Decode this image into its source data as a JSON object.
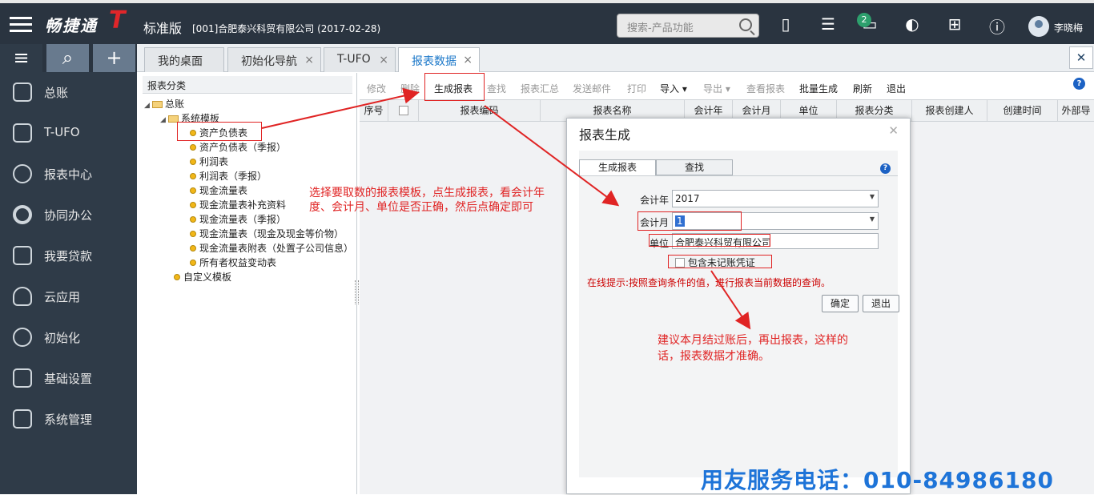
{
  "app": {
    "logo_text": "畅捷通",
    "logo_t": "T",
    "edition": "标准版",
    "company": "[001]合肥泰兴科贸有限公司  (2017-02-28)"
  },
  "search": {
    "placeholder": "搜索-产品功能"
  },
  "notifications": {
    "count": "2"
  },
  "user": {
    "name": "李晓梅"
  },
  "sidebar": {
    "items": [
      {
        "label": "总账",
        "icon": "ledger-icon"
      },
      {
        "label": "T-UFO",
        "icon": "ufo-icon"
      },
      {
        "label": "报表中心",
        "icon": "chart-icon"
      },
      {
        "label": "协同办公",
        "icon": "collaboration-icon"
      },
      {
        "label": "我要贷款",
        "icon": "loan-icon"
      },
      {
        "label": "云应用",
        "icon": "cloud-icon"
      },
      {
        "label": "初始化",
        "icon": "init-icon"
      },
      {
        "label": "基础设置",
        "icon": "settings-icon"
      },
      {
        "label": "系统管理",
        "icon": "system-icon"
      }
    ]
  },
  "tabs": [
    {
      "label": "我的桌面"
    },
    {
      "label": "初始化导航"
    },
    {
      "label": "T-UFO"
    },
    {
      "label": "报表数据"
    }
  ],
  "tree": {
    "header": "报表分类",
    "root": "总账",
    "system_templates": "系统模板",
    "items": [
      "资产负债表",
      "资产负债表（季报）",
      "利润表",
      "利润表（季报）",
      "现金流量表",
      "现金流量表补充资料",
      "现金流量表（季报）",
      "现金流量表（现金及现金等价物）",
      "现金流量表附表（处置子公司信息）",
      "所有者权益变动表"
    ],
    "custom": "自定义模板"
  },
  "toolbar": {
    "buttons": [
      "修改",
      "删除",
      "生成报表",
      "查找",
      "报表汇总",
      "发送邮件",
      "打印",
      "导入",
      "导出",
      "查看报表",
      "批量生成",
      "刷新",
      "退出"
    ]
  },
  "grid": {
    "columns": [
      "序号",
      "",
      "报表编码",
      "报表名称",
      "会计年",
      "会计月",
      "单位",
      "报表分类",
      "报表创建人",
      "创建时间",
      "外部导"
    ]
  },
  "dialog": {
    "title": "报表生成",
    "tabs": [
      "生成报表",
      "查找"
    ],
    "year_label": "会计年",
    "year_value": "2017",
    "month_label": "会计月",
    "month_value": "1",
    "unit_label": "单位",
    "unit_value": "合肥泰兴科贸有限公司",
    "include_label": "包含未记账凭证",
    "hint": "在线提示:按照查询条件的值，进行报表当前数据的查询。",
    "ok": "确定",
    "exit": "退出"
  },
  "annotations": {
    "note1_line1": "选择要取数的报表模板，点生成报表，看会计年",
    "note1_line2": "度、会计月、单位是否正确，然后点确定即可",
    "note2_line1": "建议本月结过账后，再出报表，这样的",
    "note2_line2": "话，报表数据才准确。",
    "phone": "用友服务电话：010-84986180"
  }
}
